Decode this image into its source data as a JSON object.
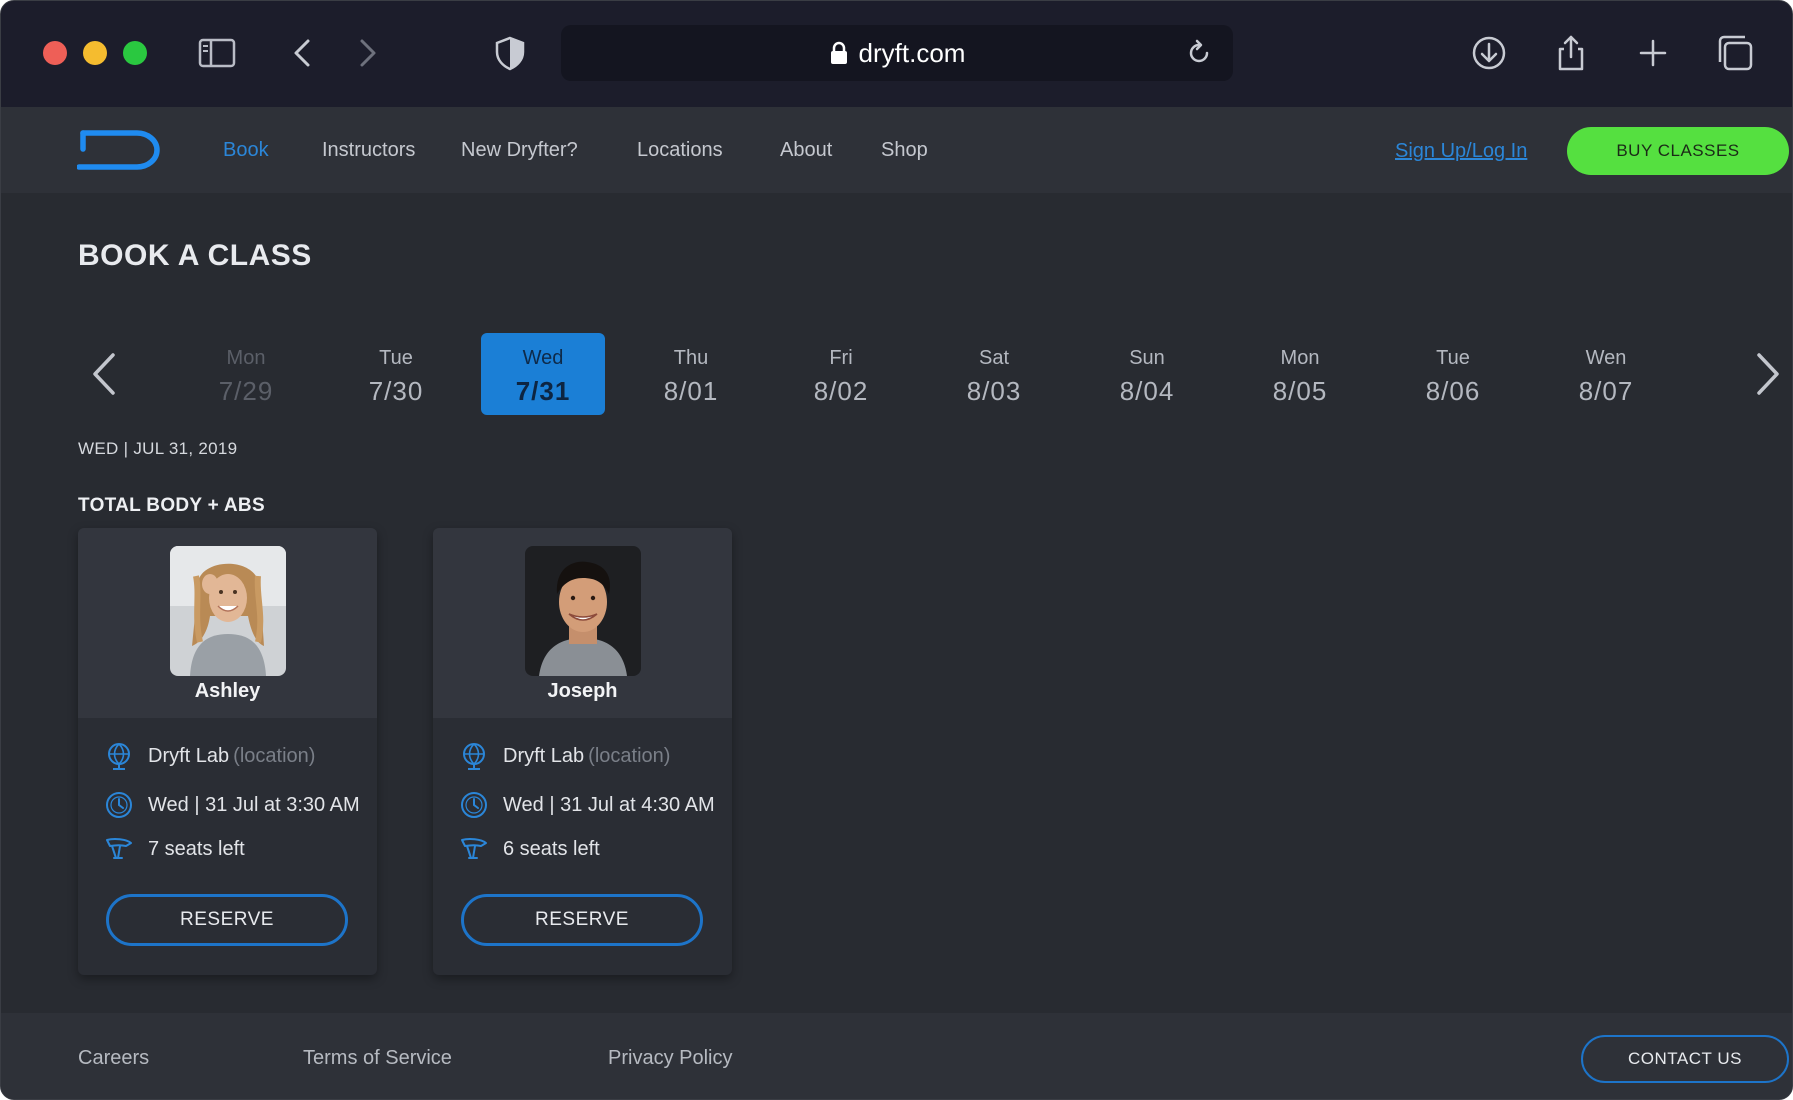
{
  "browser": {
    "url": "dryft.com",
    "icons": [
      "sidebar-icon",
      "back-icon",
      "forward-icon",
      "shield-icon",
      "lock-icon",
      "reload-icon",
      "download-icon",
      "share-icon",
      "new-tab-icon",
      "tabs-icon"
    ]
  },
  "nav": {
    "items": [
      "Book",
      "Instructors",
      "New Dryfter?",
      "Locations",
      "About",
      "Shop"
    ],
    "active": "Book",
    "signup_label": "Sign Up/Log In",
    "buy_label": "BUY CLASSES"
  },
  "colors": {
    "accent": "#1b7fd6",
    "buy_button": "#55e040",
    "background": "#282b31"
  },
  "page": {
    "title": "BOOK A CLASS",
    "date_line": "WED | JUL 31, 2019",
    "section_title": "TOTAL BODY + ABS"
  },
  "days": [
    {
      "name": "Mon",
      "date": "7/29",
      "state": "past"
    },
    {
      "name": "Tue",
      "date": "7/30",
      "state": "normal"
    },
    {
      "name": "Wed",
      "date": "7/31",
      "state": "selected"
    },
    {
      "name": "Thu",
      "date": "8/01",
      "state": "normal"
    },
    {
      "name": "Fri",
      "date": "8/02",
      "state": "normal"
    },
    {
      "name": "Sat",
      "date": "8/03",
      "state": "normal"
    },
    {
      "name": "Sun",
      "date": "8/04",
      "state": "normal"
    },
    {
      "name": "Mon",
      "date": "8/05",
      "state": "normal"
    },
    {
      "name": "Tue",
      "date": "8/06",
      "state": "normal"
    },
    {
      "name": "Wen",
      "date": "8/07",
      "state": "normal"
    }
  ],
  "classes": [
    {
      "instructor": "Ashley",
      "location": "Dryft Lab",
      "location_suffix": "(location)",
      "time": "Wed | 31 Jul at 3:30 AM",
      "seats": "7 seats left",
      "button": "RESERVE"
    },
    {
      "instructor": "Joseph",
      "location": "Dryft Lab",
      "location_suffix": "(location)",
      "time": "Wed | 31 Jul at 4:30 AM",
      "seats": "6 seats left",
      "button": "RESERVE"
    }
  ],
  "footer": {
    "links": [
      "Careers",
      "Terms of Service",
      "Privacy Policy"
    ],
    "contact_label": "CONTACT US"
  }
}
